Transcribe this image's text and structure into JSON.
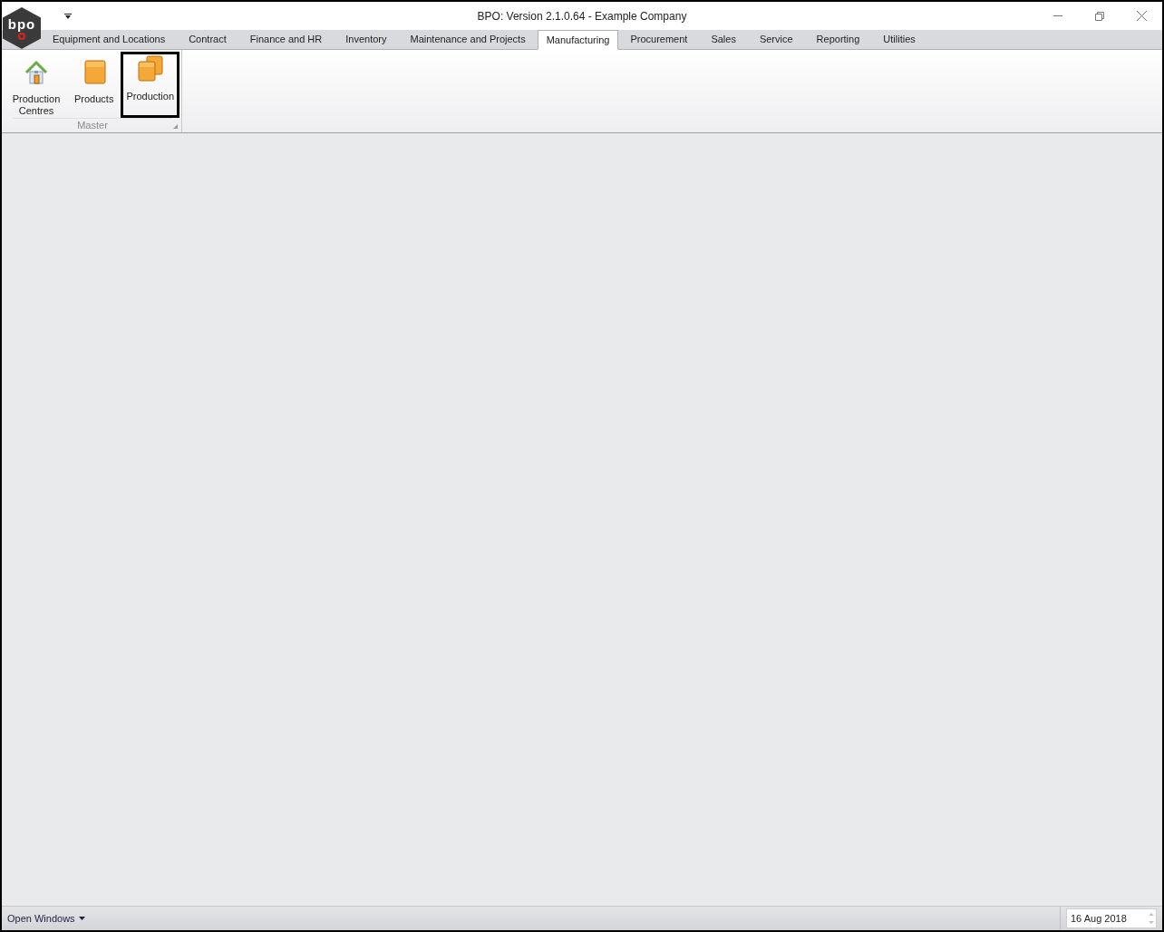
{
  "window": {
    "title": "BPO: Version 2.1.0.64 - Example Company",
    "logo_text": "bpo"
  },
  "tabs": [
    {
      "label": "Equipment and Locations",
      "selected": false
    },
    {
      "label": "Contract",
      "selected": false
    },
    {
      "label": "Finance and HR",
      "selected": false
    },
    {
      "label": "Inventory",
      "selected": false
    },
    {
      "label": "Maintenance and Projects",
      "selected": false
    },
    {
      "label": "Manufacturing",
      "selected": true
    },
    {
      "label": "Procurement",
      "selected": false
    },
    {
      "label": "Sales",
      "selected": false
    },
    {
      "label": "Service",
      "selected": false
    },
    {
      "label": "Reporting",
      "selected": false
    },
    {
      "label": "Utilities",
      "selected": false
    }
  ],
  "ribbon": {
    "groups": [
      {
        "label": "Master",
        "buttons": [
          {
            "label": "Production Centres",
            "kind": "house",
            "focused": false
          },
          {
            "label": "Products",
            "kind": "box",
            "focused": false
          },
          {
            "label": "Production",
            "kind": "boxes",
            "focused": true
          }
        ]
      }
    ]
  },
  "status_bar": {
    "open_windows": "Open Windows",
    "date": "16 Aug 2018"
  }
}
